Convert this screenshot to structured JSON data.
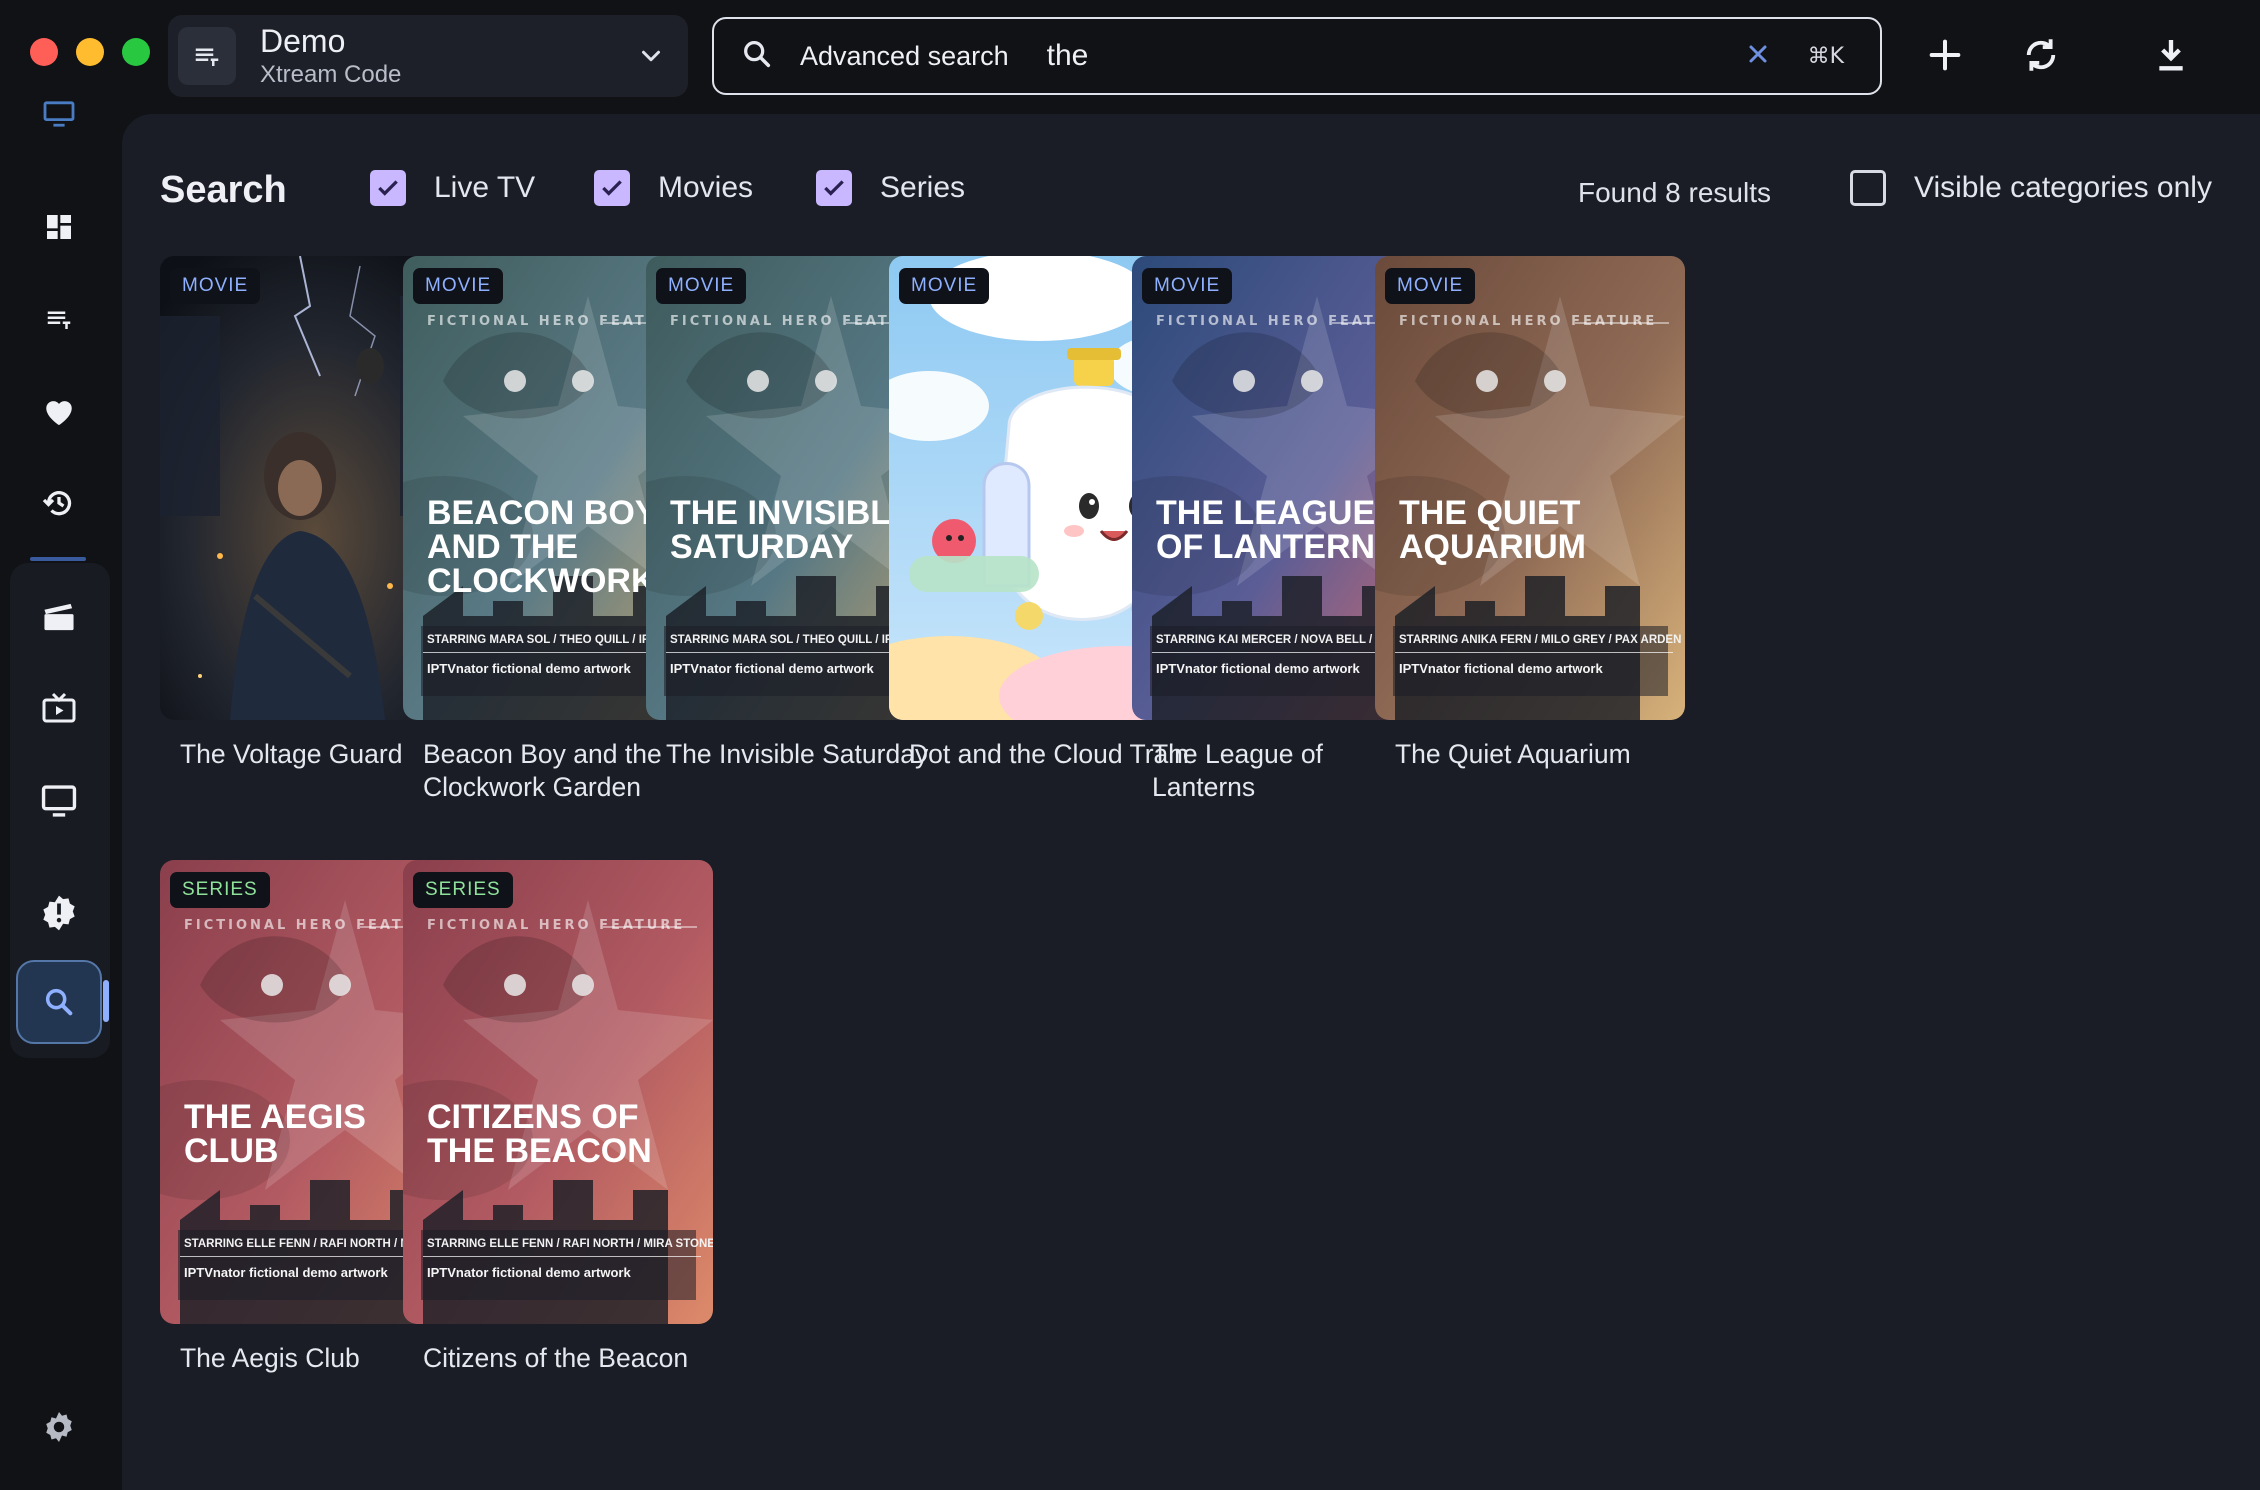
{
  "window": {
    "playlist": {
      "name": "Demo",
      "type": "Xtream Code"
    }
  },
  "search": {
    "label": "Advanced search",
    "query": "the",
    "shortcut": "⌘K"
  },
  "page": {
    "title": "Search",
    "filters": [
      {
        "label": "Live TV",
        "checked": true
      },
      {
        "label": "Movies",
        "checked": true
      },
      {
        "label": "Series",
        "checked": true
      }
    ],
    "results_text": "Found 8 results",
    "visible_only": {
      "label": "Visible categories only",
      "checked": false
    }
  },
  "results": [
    {
      "kind": "MOVIE",
      "title": "The Voltage Guard",
      "poster": {
        "style": "photo"
      }
    },
    {
      "kind": "MOVIE",
      "title": "Beacon Boy and the Clockwork Garden",
      "poster": {
        "style": "fictional",
        "feature": "FICTIONAL HERO FEATURE",
        "headline": "BEACON BOY AND THE CLOCKWORK",
        "credits": "STARRING MARA SOL / THEO QUILL / IRIS VALE",
        "note": "IPTVnator fictional demo artwork",
        "colors": [
          "#3f5d5c",
          "#5a7a86",
          "#c9a66b"
        ]
      }
    },
    {
      "kind": "MOVIE",
      "title": "The Invisible Saturday",
      "poster": {
        "style": "fictional",
        "feature": "FICTIONAL HERO FEATURE",
        "headline": "THE INVISIBLE SATURDAY",
        "credits": "STARRING MARA SOL / THEO QUILL / IRIS VALE",
        "note": "IPTVnator fictional demo artwork",
        "colors": [
          "#3e5b5c",
          "#567884",
          "#c7a46c"
        ]
      }
    },
    {
      "kind": "MOVIE",
      "title": "Dot and the Cloud Train",
      "poster": {
        "style": "cartoon"
      }
    },
    {
      "kind": "MOVIE",
      "title": "The League of Lanterns",
      "poster": {
        "style": "fictional",
        "feature": "FICTIONAL HERO FEATURE",
        "headline": "THE LEAGUE OF LANTERNS",
        "credits": "STARRING KAI MERCER / NOVA BELL / REN SATO",
        "note": "IPTVnator fictional demo artwork",
        "colors": [
          "#2c4a7a",
          "#5a5d96",
          "#d86a6a"
        ]
      }
    },
    {
      "kind": "MOVIE",
      "title": "The Quiet Aquarium",
      "poster": {
        "style": "fictional",
        "feature": "FICTIONAL HERO FEATURE",
        "headline": "THE QUIET AQUARIUM",
        "credits": "STARRING ANIKA FERN / MILO GREY / PAX ARDEN",
        "note": "IPTVnator fictional demo artwork",
        "colors": [
          "#6b4a3b",
          "#8f6a55",
          "#d8b27a"
        ]
      }
    },
    {
      "kind": "SERIES",
      "title": "The Aegis Club",
      "poster": {
        "style": "fictional",
        "feature": "FICTIONAL HERO FEATURE",
        "headline": "THE AEGIS CLUB",
        "credits": "STARRING ELLE FENN / RAFI NORTH / MIRA STONE",
        "note": "IPTVnator fictional demo artwork",
        "colors": [
          "#8a3f4c",
          "#b25a62",
          "#dd8a6a"
        ]
      }
    },
    {
      "kind": "SERIES",
      "title": "Citizens of the Beacon",
      "poster": {
        "style": "fictional",
        "feature": "FICTIONAL HERO FEATURE",
        "headline": "CITIZENS OF THE BEACON",
        "credits": "STARRING ELLE FENN / RAFI NORTH / MIRA STONE",
        "note": "IPTVnator fictional demo artwork",
        "colors": [
          "#8a3f4c",
          "#b25a62",
          "#dd8a6a"
        ]
      }
    }
  ],
  "sidebar": {
    "items": [
      {
        "icon": "monitor-icon"
      },
      {
        "icon": "dashboard-icon"
      },
      {
        "icon": "playlist-icon"
      },
      {
        "icon": "heart-icon"
      },
      {
        "icon": "history-icon"
      },
      {
        "icon": "movie-clapper-icon"
      },
      {
        "icon": "series-tv-icon"
      },
      {
        "icon": "live-tv-icon"
      },
      {
        "icon": "alert-badge-icon"
      },
      {
        "icon": "search-icon",
        "active": true
      },
      {
        "icon": "settings-gear-icon"
      }
    ]
  },
  "colors": {
    "accent": "#c9b7ff",
    "movie_badge": "#8fb0ff",
    "series_badge": "#8fe29a",
    "background": "#1a1d25"
  }
}
